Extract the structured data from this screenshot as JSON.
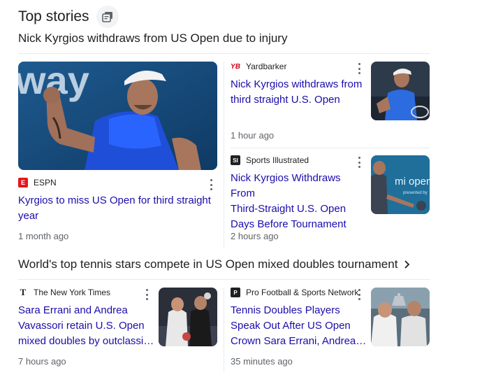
{
  "header": {
    "title": "Top stories"
  },
  "cluster1": {
    "title": "Nick Kyrgios withdraws from US Open due to injury",
    "main_story": {
      "source": "ESPN",
      "headline_line1": "Kyrgios to miss US Open for third straight",
      "headline_line2": "year",
      "time": "1 month ago"
    },
    "story2": {
      "source": "Yardbarker",
      "headline_line1": "Nick Kyrgios withdraws from",
      "headline_line2": "third straight U.S. Open",
      "time": "1 hour ago"
    },
    "story3": {
      "source": "Sports Illustrated",
      "headline_line1": "Nick Kyrgios Withdraws From",
      "headline_line2": "Third-Straight U.S. Open",
      "headline_line3": "Days Before Tournament",
      "time": "2 hours ago"
    }
  },
  "cluster2": {
    "title": "World's top tennis stars compete in US Open mixed doubles tournament",
    "story1": {
      "source": "The New York Times",
      "headline_line1": "Sara Errani and Andrea",
      "headline_line2": "Vavassori retain U.S. Open",
      "headline_line3": "mixed doubles by outclassi…",
      "time": "7 hours ago"
    },
    "story2": {
      "source": "Pro Football & Sports Network",
      "headline_line1": "Tennis Doubles Players",
      "headline_line2": "Speak Out After US Open",
      "headline_line3": "Crown Sara Errani, Andrea…",
      "time": "35 minutes ago"
    }
  },
  "logos": {
    "espn": "E",
    "yardbarker": "YB",
    "si": "SI",
    "nyt": "T",
    "pfsn": "P"
  },
  "thumbnail_text": {
    "big_banner": "way",
    "si_banner_line1": "mi open",
    "si_banner_line2": "presented by"
  },
  "colors": {
    "link": "#1a0dab",
    "espn": "#e8141c",
    "yardbarker": "#d0021b",
    "text_secondary": "#5f6368"
  }
}
